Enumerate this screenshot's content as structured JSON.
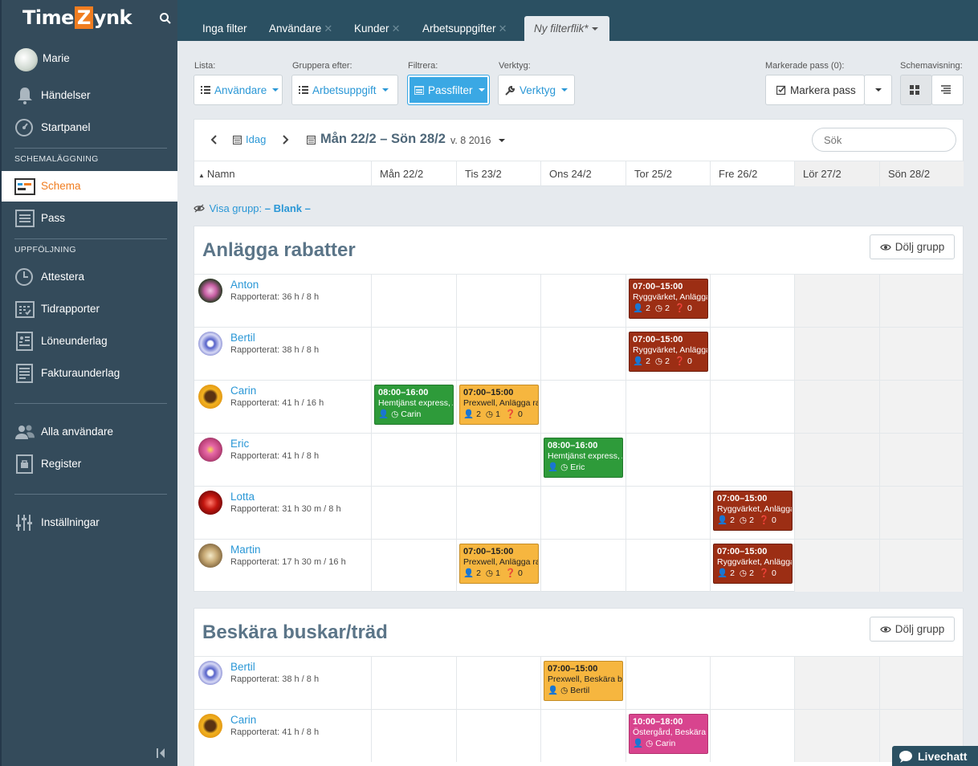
{
  "app": {
    "logo_left": "Time",
    "logo_z": "Z",
    "logo_right": "ynk"
  },
  "sidebar": {
    "user": "Marie",
    "items": {
      "handelser": "Händelser",
      "startpanel": "Startpanel",
      "schema": "Schema",
      "pass": "Pass",
      "attestera": "Attestera",
      "tidrapporter": "Tidrapporter",
      "loneunderlag": "Löneunderlag",
      "fakturaunderlag": "Fakturaunderlag",
      "alla_anvandare": "Alla användare",
      "register": "Register",
      "installningar": "Inställningar"
    },
    "sections": {
      "schemalaggning": "SCHEMALÄGGNING",
      "uppfoljning": "UPPFÖLJNING"
    }
  },
  "tabs": [
    "Inga filter",
    "Användare",
    "Kunder",
    "Arbetsuppgifter",
    "Ny filterflik*"
  ],
  "toolbar": {
    "lista_label": "Lista:",
    "lista_value": "Användare",
    "gruppera_label": "Gruppera efter:",
    "gruppera_value": "Arbetsuppgift",
    "filtrera_label": "Filtrera:",
    "filtrera_value": "Passfilter",
    "verktyg_label": "Verktyg:",
    "verktyg_value": "Verktyg",
    "markerade_label": "Markerade pass (0):",
    "markera_button": "Markera pass",
    "schemavisning_label": "Schemavisning:"
  },
  "calendar": {
    "today": "Idag",
    "range": "Mån 22/2 – Sön 28/2",
    "week": "v. 8 2016",
    "search_placeholder": "Sök",
    "name_header": "Namn",
    "days": [
      "Mån 22/2",
      "Tis 23/2",
      "Ons 24/2",
      "Tor 25/2",
      "Fre 26/2",
      "Lör 27/2",
      "Sön 28/2"
    ]
  },
  "visa_grupp": {
    "label": "Visa grupp:",
    "value": "– Blank –"
  },
  "groups": [
    {
      "title": "Anlägga rabatter",
      "hide_button": "Dölj grupp",
      "rows": [
        {
          "name": "Anton",
          "reported": "Rapporterat: 36 h / 8 h",
          "shifts": [
            {
              "day": 3,
              "color": "red",
              "time": "07:00–15:00",
              "desc": "Ryggvärket, Anlägga rabatter",
              "p": "2",
              "c": "2",
              "q": "0"
            }
          ]
        },
        {
          "name": "Bertil",
          "reported": "Rapporterat: 38 h / 8 h",
          "shifts": [
            {
              "day": 3,
              "color": "red",
              "time": "07:00–15:00",
              "desc": "Ryggvärket, Anlägga rabatter",
              "p": "2",
              "c": "2",
              "q": "0"
            }
          ]
        },
        {
          "name": "Carin",
          "reported": "Rapporterat: 41 h / 16 h",
          "shifts": [
            {
              "day": 0,
              "color": "green",
              "time": "08:00–16:00",
              "desc": "Hemtjänst express, Anlägga rabatter",
              "person": "Carin"
            },
            {
              "day": 1,
              "color": "yellow",
              "time": "07:00–15:00",
              "desc": "Prexwell, Anlägga rabatter",
              "p": "2",
              "c": "1",
              "q": "0"
            }
          ]
        },
        {
          "name": "Eric",
          "reported": "Rapporterat: 41 h / 8 h",
          "shifts": [
            {
              "day": 2,
              "color": "green",
              "time": "08:00–16:00",
              "desc": "Hemtjänst express, Anlägga rabatter",
              "person": "Eric"
            }
          ]
        },
        {
          "name": "Lotta",
          "reported": "Rapporterat: 31 h 30 m / 8 h",
          "shifts": [
            {
              "day": 4,
              "color": "red",
              "time": "07:00–15:00",
              "desc": "Ryggvärket, Anlägga rabatter",
              "p": "2",
              "c": "2",
              "q": "0"
            }
          ]
        },
        {
          "name": "Martin",
          "reported": "Rapporterat: 17 h 30 m / 16 h",
          "shifts": [
            {
              "day": 1,
              "color": "yellow",
              "time": "07:00–15:00",
              "desc": "Prexwell, Anlägga rabatter",
              "p": "2",
              "c": "1",
              "q": "0"
            },
            {
              "day": 4,
              "color": "red",
              "time": "07:00–15:00",
              "desc": "Ryggvärket, Anlägga rabatter",
              "p": "2",
              "c": "2",
              "q": "0"
            }
          ]
        }
      ]
    },
    {
      "title": "Beskära buskar/träd",
      "hide_button": "Dölj grupp",
      "rows": [
        {
          "name": "Bertil",
          "reported": "Rapporterat: 38 h / 8 h",
          "shifts": [
            {
              "day": 2,
              "color": "yellow",
              "time": "07:00–15:00",
              "desc": "Prexwell, Beskära buskar/träd",
              "person": "Bertil"
            }
          ]
        },
        {
          "name": "Carin",
          "reported": "Rapporterat: 41 h / 8 h",
          "shifts": [
            {
              "day": 3,
              "color": "pink",
              "time": "10:00–18:00",
              "desc": "Östergård, Beskära buskar/träd",
              "person": "Carin"
            }
          ]
        }
      ]
    }
  ],
  "livechat": "Livechatt"
}
